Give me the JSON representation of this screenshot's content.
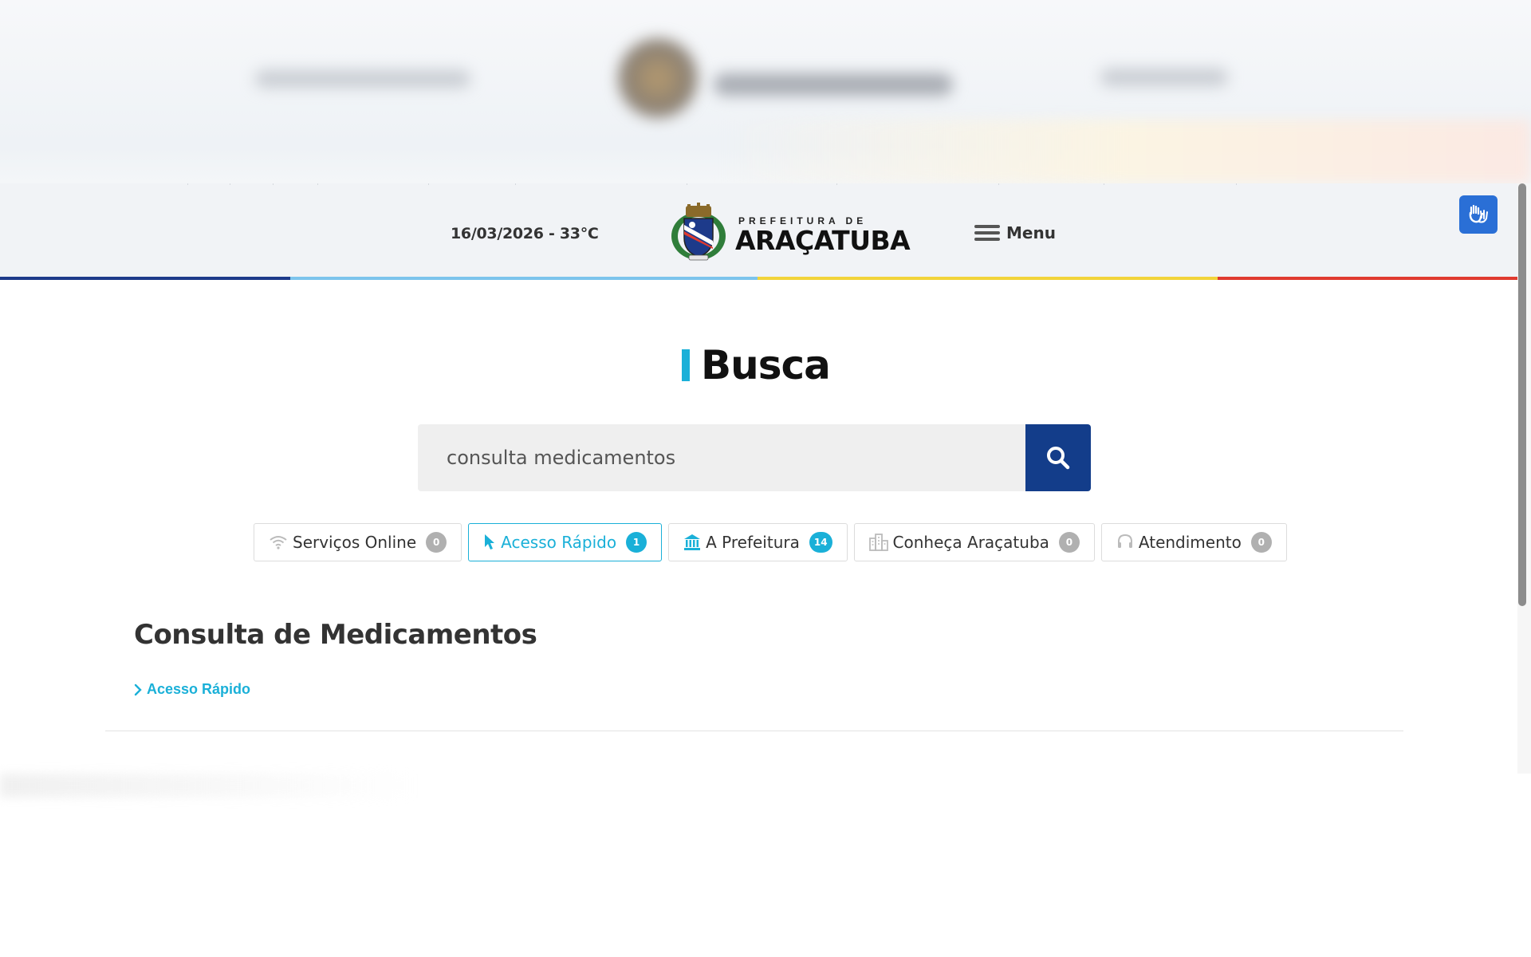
{
  "header": {
    "date_weather": "16/03/2026 - 33°C",
    "logo_sup": "PREFEITURA DE",
    "logo_name": "ARAÇATUBA",
    "menu_label": "Menu"
  },
  "colors": {
    "accent": "#1ab0d8",
    "search_button": "#133d8a",
    "accessibility_button": "#2a6fd6",
    "stripe_colors": [
      "#1d3a8a",
      "#7cc4ec",
      "#f2d33a",
      "#e03a2f"
    ]
  },
  "search": {
    "title": "Busca",
    "query": "consulta medicamentos",
    "button_icon": "search-icon"
  },
  "tabs": [
    {
      "label": "Serviços Online",
      "count": "0",
      "icon": "wifi-icon",
      "active": false
    },
    {
      "label": "Acesso Rápido",
      "count": "1",
      "icon": "cursor-icon",
      "active": true
    },
    {
      "label": "A Prefeitura",
      "count": "14",
      "icon": "bank-icon",
      "active": false
    },
    {
      "label": "Conheça Araçatuba",
      "count": "0",
      "icon": "city-icon",
      "active": false
    },
    {
      "label": "Atendimento",
      "count": "0",
      "icon": "headset-icon",
      "active": false
    }
  ],
  "result": {
    "title": "Consulta de Medicamentos",
    "category_link": "Acesso Rápido"
  }
}
